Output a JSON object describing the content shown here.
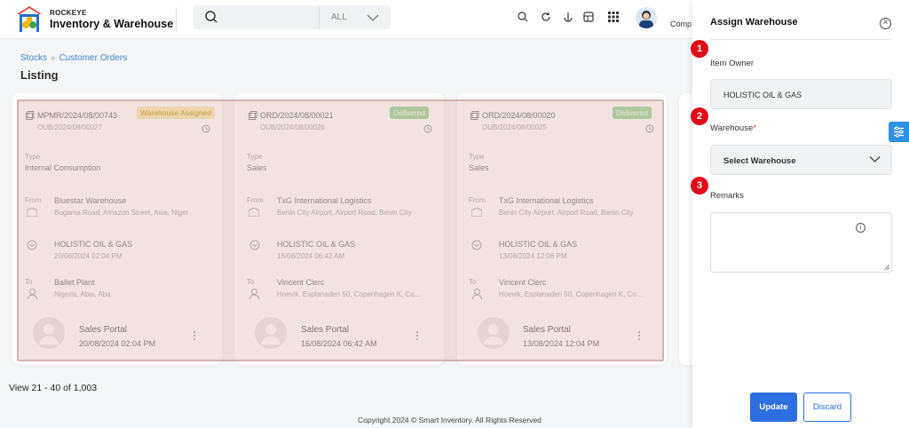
{
  "header": {
    "brand_sub": "ROCKEYE",
    "brand_main": "Inventory & Warehouse",
    "search_placeholder": "",
    "search_scope": "ALL",
    "company_label": "Comp"
  },
  "breadcrumb": {
    "item1": "Stocks",
    "sep": "»",
    "item2": "Customer Orders"
  },
  "page_title": "Listing",
  "cards": [
    {
      "order_no": "MPMR/2024/08/00743",
      "sub_no": "OUB/2024/08/00027",
      "badge": "Warehouse Assigned",
      "type_label": "Type",
      "type_value": "Internal Consumption",
      "from_label": "From",
      "from_name": "Bluestar Warehouse",
      "from_addr": "Bugama Road, Amazon Street, Asia, Niger",
      "mid_name": "HOLISTIC OIL & GAS",
      "mid_time": "20/08/2024 02:04 PM",
      "to_label": "To",
      "to_name": "Ballet Plant",
      "to_addr": "Nigeria, Abia, Aba",
      "portal": "Sales Portal",
      "portal_time": "20/08/2024 02:04 PM"
    },
    {
      "order_no": "ORD/2024/08/00021",
      "sub_no": "OUB/2024/08/00026",
      "badge": "Delivered",
      "type_label": "Type",
      "type_value": "Sales",
      "from_label": "From",
      "from_name": "TxG International Logistics",
      "from_addr": "Benin City Airport, Airport Road, Benin City",
      "mid_name": "HOLISTIC OIL & GAS",
      "mid_time": "16/08/2024 06:42 AM",
      "to_label": "To",
      "to_name": "Vincent Clerc",
      "to_addr": "Hoevik, Esplanaden 50, Copenhagen K, Co...",
      "portal": "Sales Portal",
      "portal_time": "16/08/2024 06:42 AM"
    },
    {
      "order_no": "ORD/2024/08/00020",
      "sub_no": "OUB/2024/08/00025",
      "badge": "Delivered",
      "type_label": "Type",
      "type_value": "Sales",
      "from_label": "From",
      "from_name": "TxG International Logistics",
      "from_addr": "Benin City Airport, Airport Road, Benin City",
      "mid_name": "HOLISTIC OIL & GAS",
      "mid_time": "13/08/2024 12:06 PM",
      "to_label": "To",
      "to_name": "Vincent Clerc",
      "to_addr": "Hoevik, Esplanaden 50, Copenhagen K, Co...",
      "portal": "Sales Portal",
      "portal_time": "13/08/2024 12:04 PM"
    }
  ],
  "pagination_text": "View 21 - 40 of 1,003",
  "copyright": "Copyright 2024 © Smart Inventory. All Rights Reserved",
  "panel": {
    "title": "Assign Warehouse",
    "close_glyph": "×",
    "item_owner_label": "Item Owner",
    "item_owner_value": "HOLISTIC OIL & GAS",
    "warehouse_label": "Warehouse",
    "warehouse_required": "*",
    "warehouse_value": "Select Warehouse",
    "remarks_label": "Remarks",
    "remarks_value": "",
    "info_glyph": "i",
    "update_label": "Update",
    "discard_label": "Discard"
  },
  "steps": [
    "1",
    "2",
    "3"
  ],
  "colors": {
    "accent": "#2d6fe0",
    "step": "#e10b17",
    "badge_assigned": "#f2c94c",
    "badge_delivered": "#4caf50"
  }
}
